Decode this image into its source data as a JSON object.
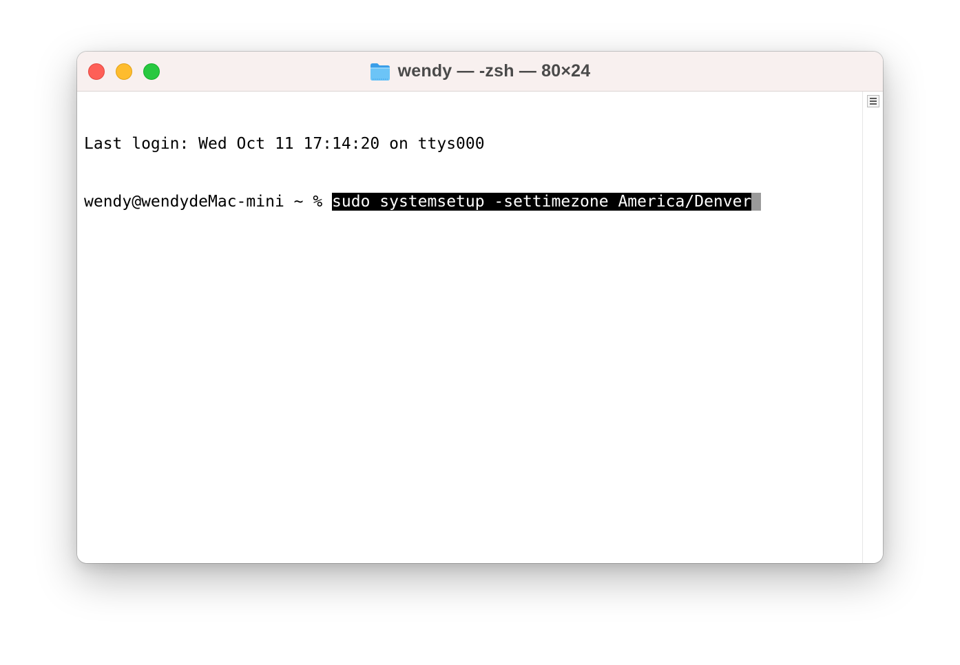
{
  "window": {
    "title": "wendy — -zsh — 80×24",
    "folder_icon": "folder-icon"
  },
  "traffic_lights": {
    "close_color": "#fe5f57",
    "minimize_color": "#febc2e",
    "zoom_color": "#28c840"
  },
  "terminal": {
    "line1": "Last login: Wed Oct 11 17:14:20 on ttys000",
    "prompt": "wendy@wendydeMac-mini ~ % ",
    "command": "sudo systemsetup -settimezone America/Denver"
  },
  "colors": {
    "titlebar": "#f8f0ef",
    "selection_bg": "#000000",
    "selection_fg": "#ffffff",
    "cursor": "#9a9a9a"
  }
}
